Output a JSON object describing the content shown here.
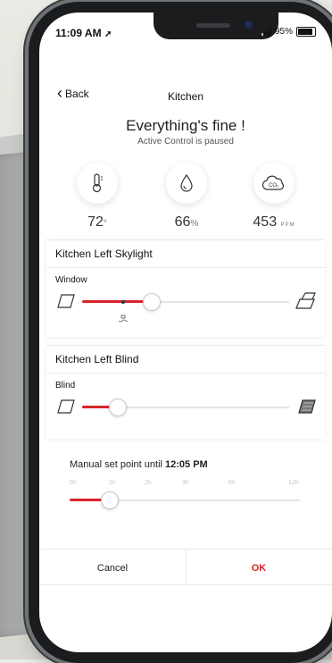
{
  "status_bar": {
    "time": "11:09 AM",
    "battery": "95%"
  },
  "nav": {
    "back_label": "Back",
    "title": "Kitchen"
  },
  "summary": {
    "headline": "Everything's fine !",
    "subline": "Active Control is paused"
  },
  "sensors": [
    {
      "icon": "thermometer-icon",
      "value": "72",
      "unit": "°"
    },
    {
      "icon": "humidity-drop-icon",
      "value": "66",
      "unit": "%"
    },
    {
      "icon": "co2-cloud-icon",
      "value": "453",
      "unit": "PPM"
    }
  ],
  "devices": [
    {
      "title": "Kitchen Left Skylight",
      "control_label": "Window",
      "level": 0.33,
      "marker_level": 0.2
    },
    {
      "title": "Kitchen Left Blind",
      "control_label": "Blind",
      "level": 0.17
    }
  ],
  "manual": {
    "prefix": "Manual set point until",
    "time": "12:05 PM",
    "ticks": [
      "0h",
      "1h",
      "2h",
      "3h",
      "6h",
      "12h"
    ],
    "level": 0.17
  },
  "actions": {
    "cancel_label": "Cancel",
    "ok_label": "OK"
  },
  "colors": {
    "accent": "#d9232a"
  }
}
